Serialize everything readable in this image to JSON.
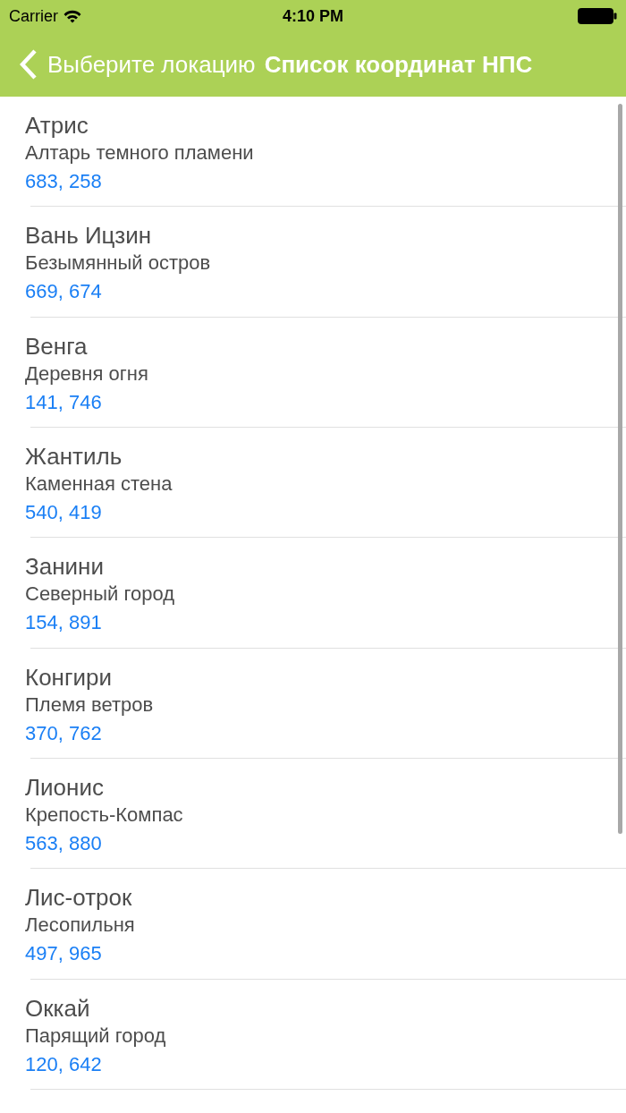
{
  "status_bar": {
    "carrier": "Carrier",
    "time": "4:10 PM"
  },
  "nav_bar": {
    "back": "Выберите локацию",
    "title": "Список координат НПС"
  },
  "npcs": [
    {
      "name": "Атрис",
      "location": "Алтарь темного пламени",
      "coordinates": "683, 258"
    },
    {
      "name": "Вань Ицзин",
      "location": "Безымянный остров",
      "coordinates": "669, 674"
    },
    {
      "name": "Венга",
      "location": "Деревня огня",
      "coordinates": "141, 746"
    },
    {
      "name": "Жантиль",
      "location": "Каменная стена",
      "coordinates": "540, 419"
    },
    {
      "name": "Занини",
      "location": "Северный город",
      "coordinates": "154, 891"
    },
    {
      "name": "Конгири",
      "location": "Племя ветров",
      "coordinates": "370, 762"
    },
    {
      "name": "Лионис",
      "location": "Крепость-Компас",
      "coordinates": "563, 880"
    },
    {
      "name": "Лис-отрок",
      "location": "Лесопильня",
      "coordinates": "497, 965"
    },
    {
      "name": "Оккай",
      "location": "Парящий город",
      "coordinates": "120, 642"
    }
  ]
}
